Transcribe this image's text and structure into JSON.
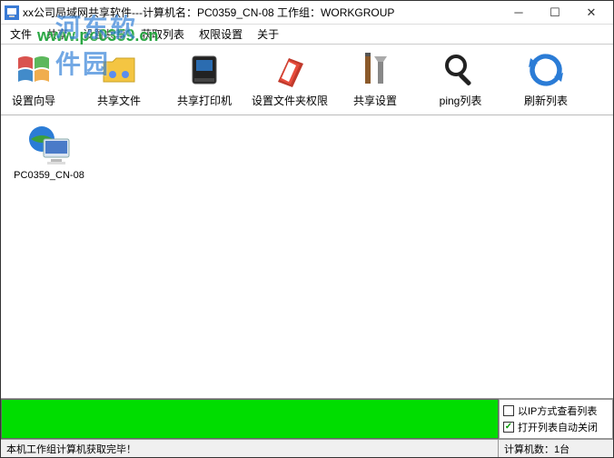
{
  "titlebar": {
    "title": "xx公司局域网共享软件---计算机名：PC0359_CN-08  工作组：WORKGROUP"
  },
  "menubar": {
    "items": [
      "文件",
      "共享",
      "设置共享",
      "获取列表",
      "权限设置",
      "关于"
    ]
  },
  "watermark": {
    "url": "www.pc0359.cn",
    "cn": "河东软件园"
  },
  "toolbar": {
    "items": [
      {
        "label": "设置向导",
        "icon": "windows-logo-icon"
      },
      {
        "label": "共享文件",
        "icon": "folder-share-icon"
      },
      {
        "label": "共享打印机",
        "icon": "printer-icon"
      },
      {
        "label": "设置文件夹权限",
        "icon": "book-icon"
      },
      {
        "label": "共享设置",
        "icon": "tools-icon"
      },
      {
        "label": "ping列表",
        "icon": "magnifier-icon"
      },
      {
        "label": "刷新列表",
        "icon": "refresh-icon"
      }
    ]
  },
  "desktop": {
    "items": [
      {
        "label": "PC0359_CN-08",
        "icon": "computer-globe-icon"
      }
    ]
  },
  "options": {
    "view_by_ip": {
      "label": "以IP方式查看列表",
      "checked": false
    },
    "auto_close": {
      "label": "打开列表自动关闭",
      "checked": true
    }
  },
  "statusbar": {
    "left": "本机工作组计算机获取完毕！",
    "right": "计算机数：1台"
  }
}
